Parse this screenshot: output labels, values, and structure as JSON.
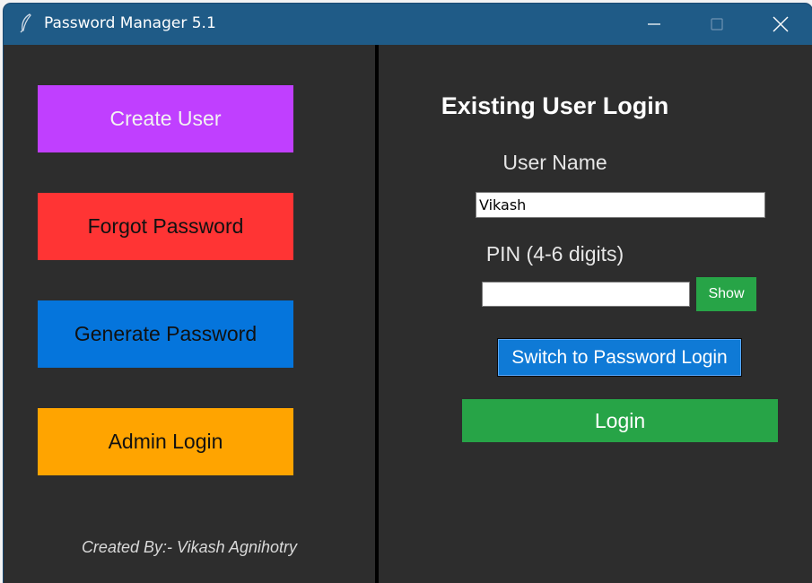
{
  "window": {
    "title": "Password Manager 5.1",
    "controls": {
      "minimize_icon": "minimize-icon",
      "maximize_icon": "maximize-icon",
      "close_icon": "close-icon"
    }
  },
  "sidebar": {
    "create_user": "Create User",
    "forgot_password": "Forgot Password",
    "generate_password": "Generate Password",
    "admin_login": "Admin Login",
    "credit": "Created By:- Vikash Agnihotry"
  },
  "login": {
    "heading": "Existing User Login",
    "username_label": "User Name",
    "username_value": "Vikash",
    "pin_label": "PIN (4-6 digits)",
    "pin_value": "",
    "show_label": "Show",
    "switch_label": "Switch to Password Login",
    "login_label": "Login"
  },
  "colors": {
    "titlebar": "#1f5b87",
    "background": "#2d2d2d",
    "create_user": "#c03fff",
    "forgot_password": "#ff3434",
    "generate_password": "#0575dc",
    "admin_login": "#ffa400",
    "green": "#27a447",
    "switch": "#0f7ad6"
  }
}
